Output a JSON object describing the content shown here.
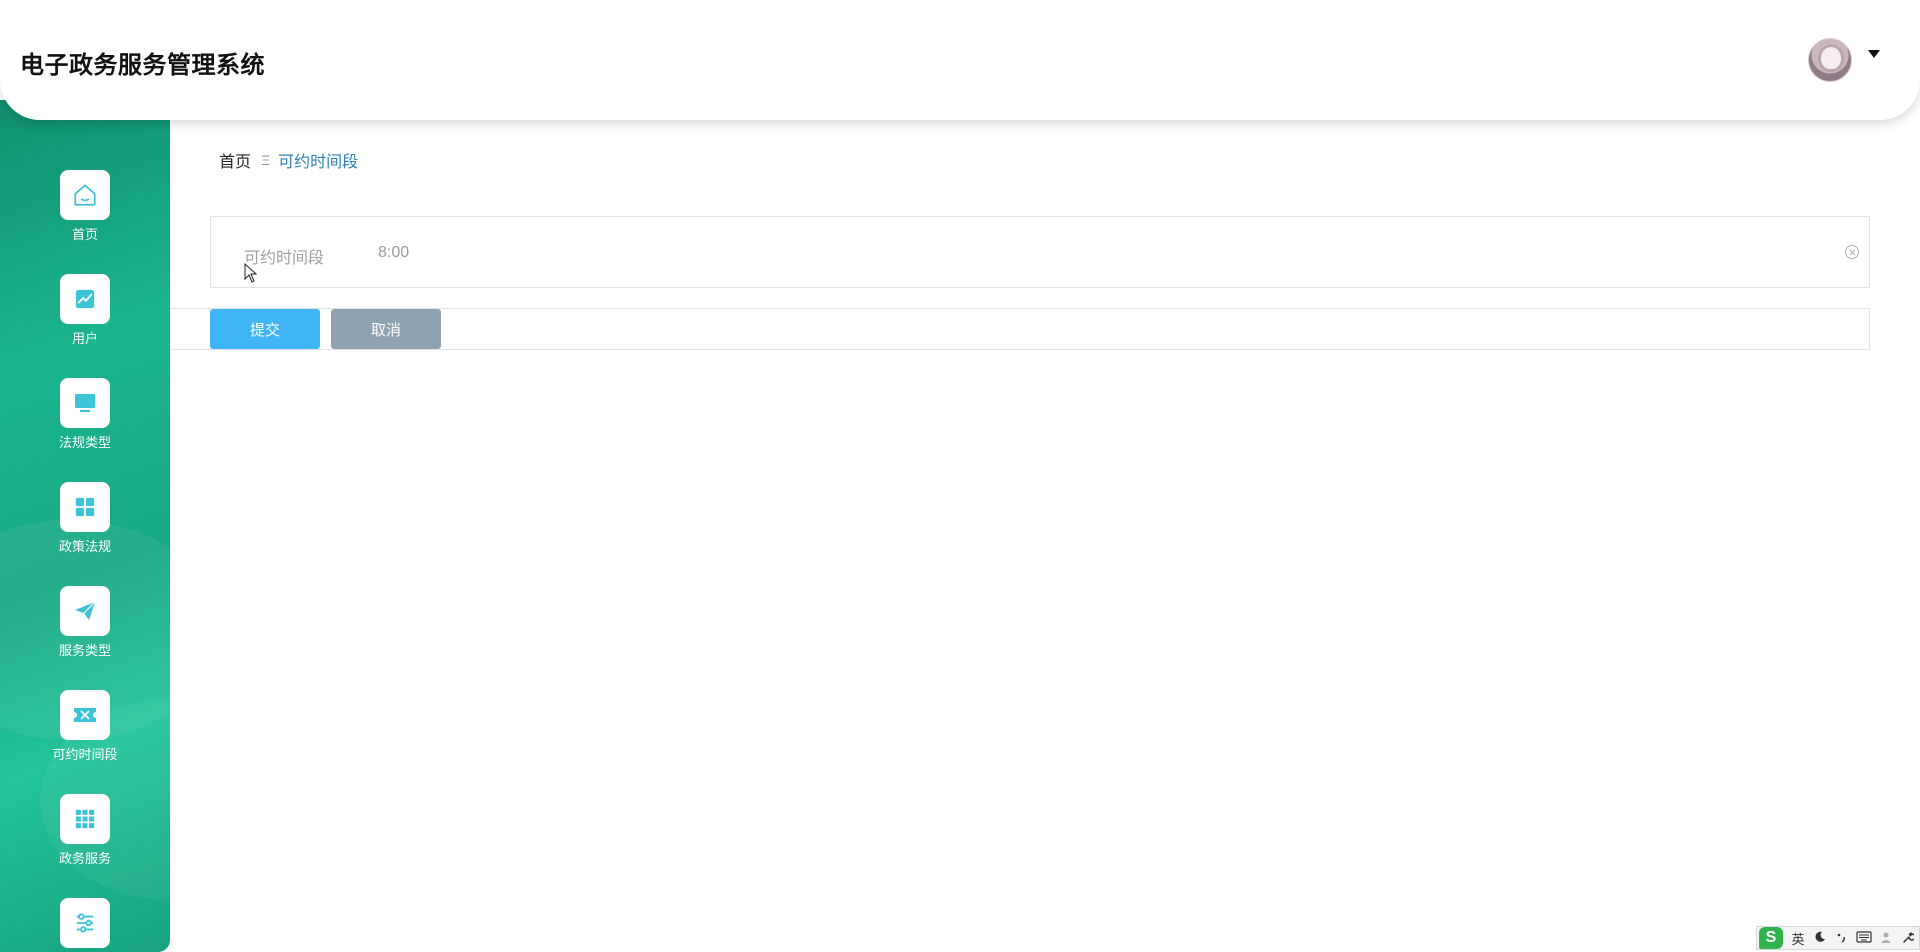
{
  "header": {
    "app_title": "电子政务服务管理系统"
  },
  "sidebar": {
    "items": [
      {
        "label": "首页",
        "icon": "home-icon"
      },
      {
        "label": "用户",
        "icon": "chart-icon"
      },
      {
        "label": "法规类型",
        "icon": "monitor-icon"
      },
      {
        "label": "政策法规",
        "icon": "grid-icon"
      },
      {
        "label": "服务类型",
        "icon": "paper-plane-icon"
      },
      {
        "label": "可约时间段",
        "icon": "ticket-icon"
      },
      {
        "label": "政务服务",
        "icon": "apps-icon"
      },
      {
        "label": "",
        "icon": "sliders-icon"
      }
    ]
  },
  "breadcrumb": {
    "home": "首页",
    "separator": "Ξ",
    "current": "可约时间段"
  },
  "form": {
    "field_label": "可约时间段",
    "field_value": "8:00",
    "submit_label": "提交",
    "cancel_label": "取消"
  },
  "ime": {
    "logo": "S",
    "mode": "英",
    "icons": [
      "moon-icon",
      "punctuation-icon",
      "keyboard-icon",
      "user-icon",
      "wrench-icon"
    ]
  },
  "colors": {
    "sidebar_gradient_start": "#0f8f6e",
    "sidebar_gradient_mid": "#1cb590",
    "icon_accent": "#3cc3d8",
    "submit_button": "#40b5f5",
    "cancel_button": "#8fa2b2",
    "breadcrumb_active": "#2e7fb8"
  }
}
